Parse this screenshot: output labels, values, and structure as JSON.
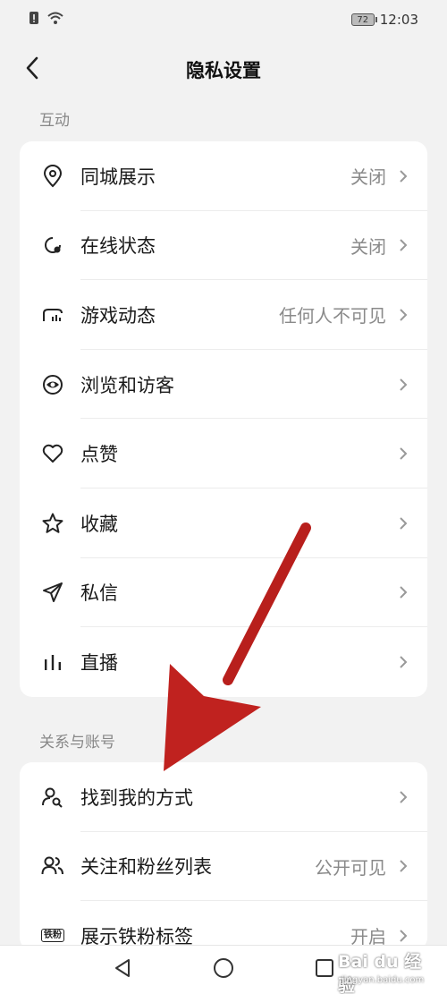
{
  "status_bar": {
    "time": "12:03",
    "battery": "72"
  },
  "header": {
    "title": "隐私设置"
  },
  "sections": [
    {
      "label": "互动",
      "items": [
        {
          "icon": "location-pin-icon",
          "label": "同城展示",
          "value": "关闭"
        },
        {
          "icon": "online-status-icon",
          "label": "在线状态",
          "value": "关闭"
        },
        {
          "icon": "gamepad-icon",
          "label": "游戏动态",
          "value": "任何人不可见"
        },
        {
          "icon": "eye-icon",
          "label": "浏览和访客",
          "value": ""
        },
        {
          "icon": "heart-icon",
          "label": "点赞",
          "value": ""
        },
        {
          "icon": "star-icon",
          "label": "收藏",
          "value": ""
        },
        {
          "icon": "send-icon",
          "label": "私信",
          "value": ""
        },
        {
          "icon": "live-bars-icon",
          "label": "直播",
          "value": ""
        }
      ]
    },
    {
      "label": "关系与账号",
      "items": [
        {
          "icon": "user-search-icon",
          "label": "找到我的方式",
          "value": ""
        },
        {
          "icon": "users-icon",
          "label": "关注和粉丝列表",
          "value": "公开可见"
        },
        {
          "icon": "iron-fan-badge-icon",
          "label": "展示铁粉标签",
          "value": "开启",
          "badge_text": "铁粉"
        }
      ]
    }
  ],
  "watermark": {
    "brand": "Bai du 经验",
    "url": "jingyan.baidu.com"
  },
  "colors": {
    "arrow": "#c0221f",
    "background": "#f2f2f2",
    "card": "#ffffff"
  }
}
